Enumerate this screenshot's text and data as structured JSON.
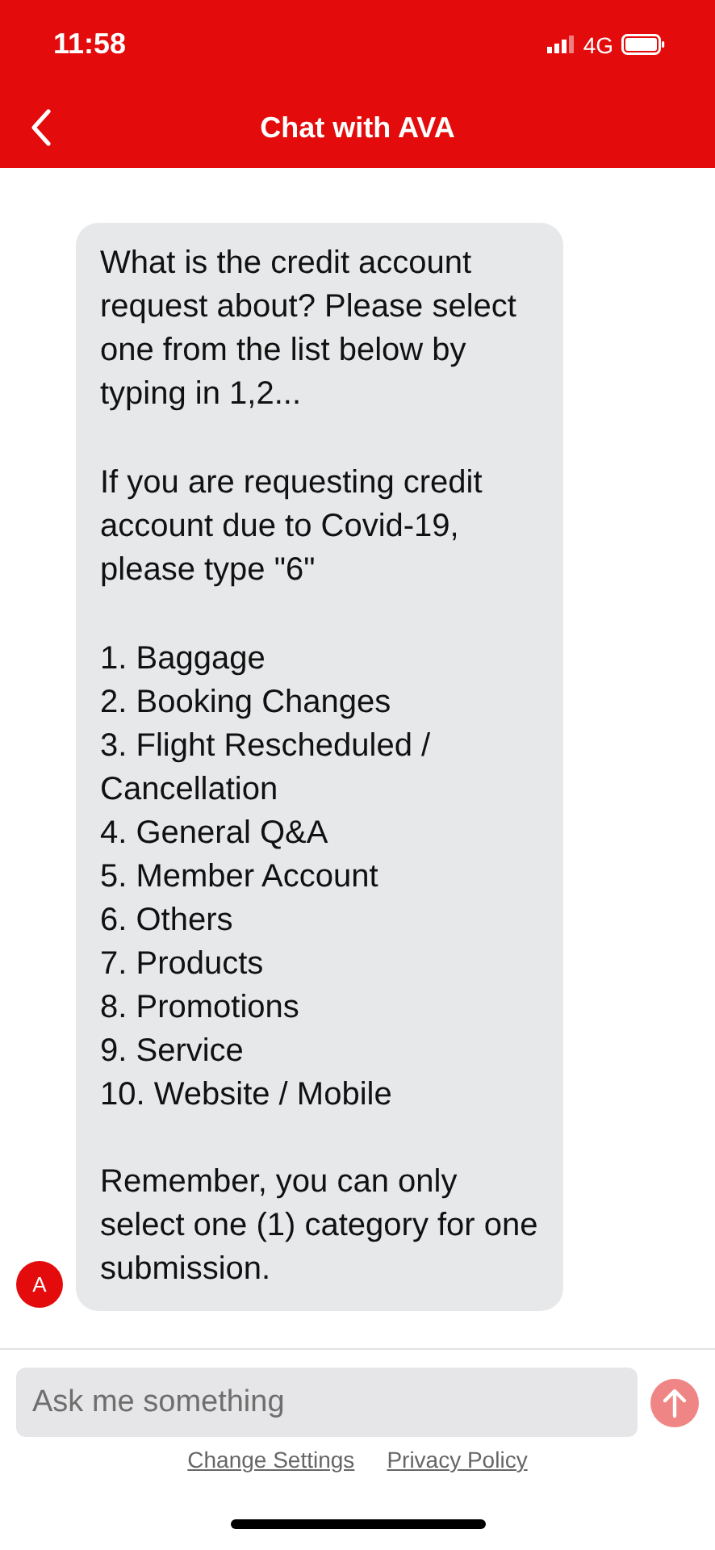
{
  "status_bar": {
    "time": "11:58",
    "network": "4G"
  },
  "header": {
    "title": "Chat with AVA"
  },
  "message": {
    "avatar": "A",
    "intro": "What is the credit account request about? Please select one from the list below by typing in 1,2...",
    "covid_note": "If you are requesting credit account due to Covid-19, please type \"6\"",
    "options": [
      "1. Baggage",
      "2. Booking Changes",
      "3. Flight Rescheduled / Cancellation",
      "4. General Q&A",
      "5. Member Account",
      "6. Others",
      "7. Products",
      "8. Promotions",
      "9. Service",
      "10. Website / Mobile"
    ],
    "reminder": "Remember, you can only select one (1) category for one submission."
  },
  "composer": {
    "placeholder": "Ask me something"
  },
  "footer_links": [
    "Change Settings",
    "Privacy Policy"
  ]
}
